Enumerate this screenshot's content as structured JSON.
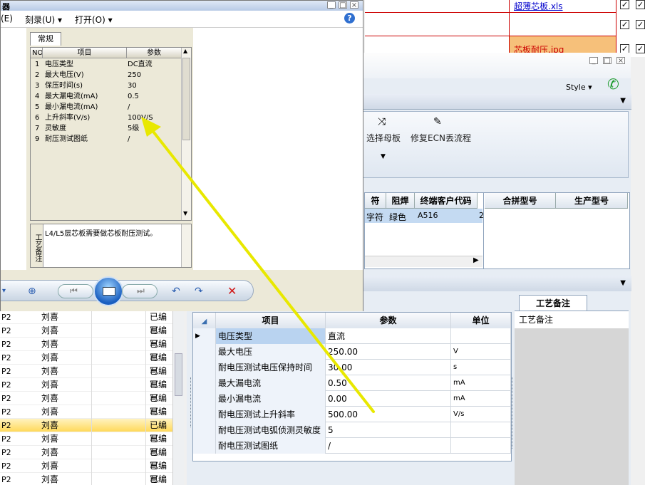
{
  "xls": {
    "link1": "超薄芯板.xls",
    "link3": "芯板耐压.jpg"
  },
  "app": {
    "style_label": "Style",
    "ribbon": {
      "btn_select_board": "选择母板",
      "btn_fix_ecn": "修复ECN丢流程"
    },
    "grid1": {
      "headers": [
        "符",
        "阻焊",
        "终端客户代码",
        "合拼型号",
        "生产型号"
      ],
      "row": [
        "字符",
        "绿色",
        "A516",
        "2"
      ]
    }
  },
  "params": {
    "headers": {
      "item": "项目",
      "param": "参数",
      "unit": "单位"
    },
    "rows": [
      {
        "item": "电压类型",
        "param": "直流",
        "unit": ""
      },
      {
        "item": "最大电压",
        "param": "250.00",
        "unit": "V"
      },
      {
        "item": "耐电压测试电压保持时间",
        "param": "30.00",
        "unit": "s"
      },
      {
        "item": "最大漏电流",
        "param": "0.50",
        "unit": "mA"
      },
      {
        "item": "最小漏电流",
        "param": "0.00",
        "unit": "mA"
      },
      {
        "item": "耐电压测试上升斜率",
        "param": "500.00",
        "unit": "V/s"
      },
      {
        "item": "耐电压测试电弧侦测灵敏度",
        "param": "5",
        "unit": ""
      },
      {
        "item": "耐电压测试图纸",
        "param": "/",
        "unit": ""
      }
    ]
  },
  "remark": {
    "tab": "工艺备注",
    "header": "工艺备注"
  },
  "leftlist": {
    "rows": [
      [
        "P2",
        "刘喜",
        "已编写"
      ],
      [
        "P2",
        "刘喜",
        "已编写"
      ],
      [
        "P2",
        "刘喜",
        "已编写"
      ],
      [
        "P2",
        "刘喜",
        "已编写"
      ],
      [
        "P2",
        "刘喜",
        "已编写"
      ],
      [
        "P2",
        "刘喜",
        "已编写"
      ],
      [
        "P2",
        "刘喜",
        "已编写"
      ],
      [
        "P2",
        "刘喜",
        "已编写"
      ],
      [
        "P2",
        "刘喜",
        "已编写"
      ],
      [
        "P2",
        "刘喜",
        "已编写"
      ],
      [
        "P2",
        "刘喜",
        "已编写"
      ],
      [
        "P2",
        "刘喜",
        "已编写"
      ],
      [
        "P2",
        "刘喜",
        "已编写"
      ]
    ],
    "selected_index": 8
  },
  "dialog": {
    "title": "器",
    "menu": [
      "(E)",
      "刻录(U)",
      "打开(O)"
    ],
    "tab": "常规",
    "table_headers": [
      "NO",
      "项目",
      "参数"
    ],
    "rows": [
      [
        "1",
        "电压类型",
        "DC直流"
      ],
      [
        "2",
        "最大电压(V)",
        "250"
      ],
      [
        "3",
        "保压时间(s)",
        "30"
      ],
      [
        "4",
        "最大漏电流(mA)",
        "0.5"
      ],
      [
        "5",
        "最小漏电流(mA)",
        "/"
      ],
      [
        "6",
        "上升斜率(V/s)",
        "100V/S"
      ],
      [
        "7",
        "灵敏度",
        "5级"
      ],
      [
        "9",
        "耐压测试图纸",
        "/"
      ]
    ],
    "memo_label": "工艺备注",
    "memo_text": "L4/L5层芯板需要做芯板耐压测试。"
  }
}
